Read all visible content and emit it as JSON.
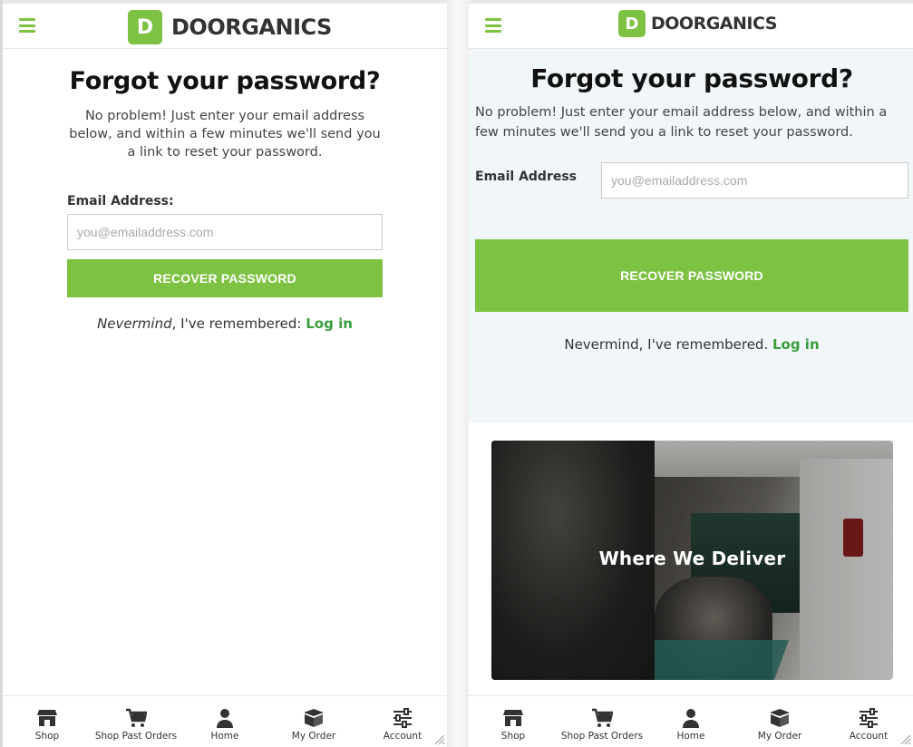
{
  "brand": {
    "logo_letter": "D",
    "logo_name": "DOORGANICS",
    "accent_color": "#7dc242",
    "link_color": "#3a9e3c"
  },
  "left": {
    "title": "Forgot your password?",
    "description": "No problem! Just enter your email address below, and within a few minutes we'll send you a link to reset your password.",
    "email_label": "Email Address:",
    "email_placeholder": "you@emailaddress.com",
    "email_value": "",
    "button_label": "RECOVER PASSWORD",
    "remember_italic": "Nevermind",
    "remember_text": ", I've remembered: ",
    "login_link": "Log in"
  },
  "right": {
    "title": "Forgot your password?",
    "description": "No problem! Just enter your email address below, and within a few minutes we'll send you a link to reset your password.",
    "email_label": "Email Address",
    "email_placeholder": "you@emailaddress.com",
    "email_value": "",
    "button_label": "RECOVER PASSWORD",
    "remember_text": "Nevermind, I've remembered. ",
    "login_link": "Log in",
    "delivery_caption": "Where We Deliver"
  },
  "bottom_nav": [
    {
      "label": "Shop",
      "icon": "shop-icon"
    },
    {
      "label": "Shop Past Orders",
      "icon": "cart-icon"
    },
    {
      "label": "Home",
      "icon": "user-icon"
    },
    {
      "label": "My Order",
      "icon": "box-icon"
    },
    {
      "label": "Account",
      "icon": "sliders-icon"
    }
  ]
}
